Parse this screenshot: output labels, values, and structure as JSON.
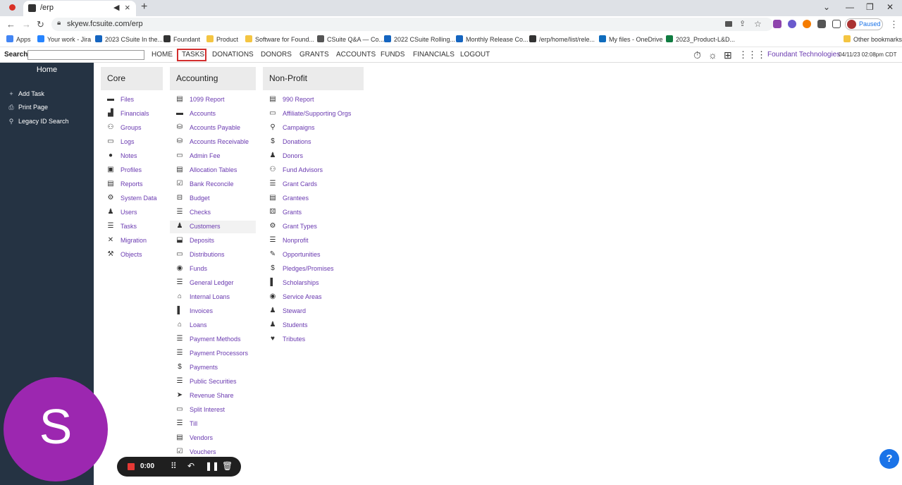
{
  "browser": {
    "tab_title": "/erp",
    "url": "skyew.fcsuite.com/erp",
    "profile_label": "Paused",
    "bookmarks": [
      {
        "label": "Apps",
        "color": "#4285f4"
      },
      {
        "label": "Your work - Jira",
        "color": "#2684ff"
      },
      {
        "label": "2023 CSuite In the...",
        "color": "#1565c0"
      },
      {
        "label": "Foundant",
        "color": "#333333"
      },
      {
        "label": "Product",
        "color": "#f4c542"
      },
      {
        "label": "Software for Found...",
        "color": "#f4c542"
      },
      {
        "label": "CSuite Q&A — Co...",
        "color": "#555555"
      },
      {
        "label": "2022 CSuite Rolling...",
        "color": "#1565c0"
      },
      {
        "label": "Monthly Release Co...",
        "color": "#1565c0"
      },
      {
        "label": "/erp/home/list/rele...",
        "color": "#333333"
      },
      {
        "label": "My files - OneDrive",
        "color": "#0f6cbd"
      },
      {
        "label": "2023_Product-L&D...",
        "color": "#107c41"
      }
    ],
    "other_bookmarks": "Other bookmarks"
  },
  "appnav": {
    "search_label": "Search:",
    "search_value": "",
    "links": [
      "HOME",
      "TASKS",
      "DONATIONS",
      "DONORS",
      "GRANTS",
      "ACCOUNTS",
      "FUNDS",
      "FINANCIALS",
      "LOGOUT"
    ],
    "company": "Foundant Technologies",
    "datetime": "04/11/23 02:08pm CDT"
  },
  "sidebar": {
    "title": "Home",
    "items": [
      {
        "label": "Add Task",
        "icon": "plus-icon"
      },
      {
        "label": "Print Page",
        "icon": "print-icon"
      },
      {
        "label": "Legacy ID Search",
        "icon": "search-icon"
      }
    ],
    "avatar_letter": "S"
  },
  "columns": {
    "core": {
      "title": "Core",
      "items": [
        "Files",
        "Financials",
        "Groups",
        "Logs",
        "Notes",
        "Profiles",
        "Reports",
        "System Data",
        "Users",
        "Tasks",
        "Migration",
        "Objects"
      ]
    },
    "accounting": {
      "title": "Accounting",
      "items": [
        "1099 Report",
        "Accounts",
        "Accounts Payable",
        "Accounts Receivable",
        "Admin Fee",
        "Allocation Tables",
        "Bank Reconcile",
        "Budget",
        "Checks",
        "Customers",
        "Deposits",
        "Distributions",
        "Funds",
        "General Ledger",
        "Internal Loans",
        "Invoices",
        "Loans",
        "Payment Methods",
        "Payment Processors",
        "Payments",
        "Public Securities",
        "Revenue Share",
        "Split Interest",
        "Till",
        "Vendors",
        "Vouchers"
      ]
    },
    "nonprofit": {
      "title": "Non-Profit",
      "items": [
        "990 Report",
        "Affiliate/Supporting Orgs",
        "Campaigns",
        "Donations",
        "Donors",
        "Fund Advisors",
        "Grant Cards",
        "Grantees",
        "Grants",
        "Grant Types",
        "Nonprofit",
        "Opportunities",
        "Pledges/Promises",
        "Scholarships",
        "Service Areas",
        "Steward",
        "Students",
        "Tributes"
      ]
    }
  },
  "recorder": {
    "time": "0:00"
  },
  "help": {
    "label": "?"
  },
  "colors": {
    "link": "#6a3ab0",
    "sidebar": "#253343",
    "avatar": "#9c27b0",
    "highlight": "#d32f2f"
  }
}
